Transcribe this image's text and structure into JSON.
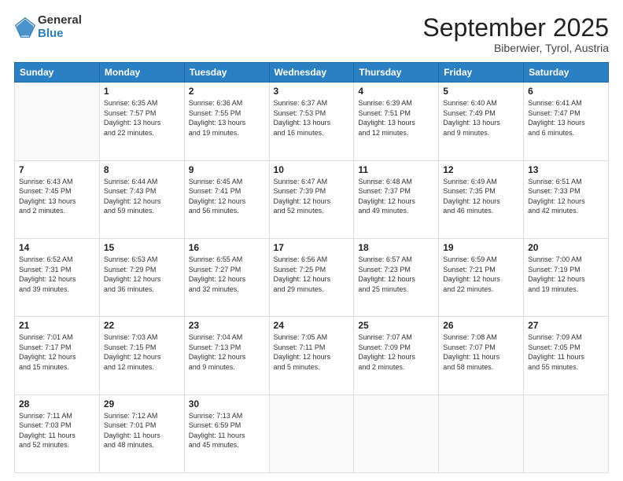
{
  "header": {
    "logo_general": "General",
    "logo_blue": "Blue",
    "month": "September 2025",
    "location": "Biberwier, Tyrol, Austria"
  },
  "weekdays": [
    "Sunday",
    "Monday",
    "Tuesday",
    "Wednesday",
    "Thursday",
    "Friday",
    "Saturday"
  ],
  "weeks": [
    [
      {
        "day": "",
        "info": ""
      },
      {
        "day": "1",
        "info": "Sunrise: 6:35 AM\nSunset: 7:57 PM\nDaylight: 13 hours\nand 22 minutes."
      },
      {
        "day": "2",
        "info": "Sunrise: 6:36 AM\nSunset: 7:55 PM\nDaylight: 13 hours\nand 19 minutes."
      },
      {
        "day": "3",
        "info": "Sunrise: 6:37 AM\nSunset: 7:53 PM\nDaylight: 13 hours\nand 16 minutes."
      },
      {
        "day": "4",
        "info": "Sunrise: 6:39 AM\nSunset: 7:51 PM\nDaylight: 13 hours\nand 12 minutes."
      },
      {
        "day": "5",
        "info": "Sunrise: 6:40 AM\nSunset: 7:49 PM\nDaylight: 13 hours\nand 9 minutes."
      },
      {
        "day": "6",
        "info": "Sunrise: 6:41 AM\nSunset: 7:47 PM\nDaylight: 13 hours\nand 6 minutes."
      }
    ],
    [
      {
        "day": "7",
        "info": "Sunrise: 6:43 AM\nSunset: 7:45 PM\nDaylight: 13 hours\nand 2 minutes."
      },
      {
        "day": "8",
        "info": "Sunrise: 6:44 AM\nSunset: 7:43 PM\nDaylight: 12 hours\nand 59 minutes."
      },
      {
        "day": "9",
        "info": "Sunrise: 6:45 AM\nSunset: 7:41 PM\nDaylight: 12 hours\nand 56 minutes."
      },
      {
        "day": "10",
        "info": "Sunrise: 6:47 AM\nSunset: 7:39 PM\nDaylight: 12 hours\nand 52 minutes."
      },
      {
        "day": "11",
        "info": "Sunrise: 6:48 AM\nSunset: 7:37 PM\nDaylight: 12 hours\nand 49 minutes."
      },
      {
        "day": "12",
        "info": "Sunrise: 6:49 AM\nSunset: 7:35 PM\nDaylight: 12 hours\nand 46 minutes."
      },
      {
        "day": "13",
        "info": "Sunrise: 6:51 AM\nSunset: 7:33 PM\nDaylight: 12 hours\nand 42 minutes."
      }
    ],
    [
      {
        "day": "14",
        "info": "Sunrise: 6:52 AM\nSunset: 7:31 PM\nDaylight: 12 hours\nand 39 minutes."
      },
      {
        "day": "15",
        "info": "Sunrise: 6:53 AM\nSunset: 7:29 PM\nDaylight: 12 hours\nand 36 minutes."
      },
      {
        "day": "16",
        "info": "Sunrise: 6:55 AM\nSunset: 7:27 PM\nDaylight: 12 hours\nand 32 minutes."
      },
      {
        "day": "17",
        "info": "Sunrise: 6:56 AM\nSunset: 7:25 PM\nDaylight: 12 hours\nand 29 minutes."
      },
      {
        "day": "18",
        "info": "Sunrise: 6:57 AM\nSunset: 7:23 PM\nDaylight: 12 hours\nand 25 minutes."
      },
      {
        "day": "19",
        "info": "Sunrise: 6:59 AM\nSunset: 7:21 PM\nDaylight: 12 hours\nand 22 minutes."
      },
      {
        "day": "20",
        "info": "Sunrise: 7:00 AM\nSunset: 7:19 PM\nDaylight: 12 hours\nand 19 minutes."
      }
    ],
    [
      {
        "day": "21",
        "info": "Sunrise: 7:01 AM\nSunset: 7:17 PM\nDaylight: 12 hours\nand 15 minutes."
      },
      {
        "day": "22",
        "info": "Sunrise: 7:03 AM\nSunset: 7:15 PM\nDaylight: 12 hours\nand 12 minutes."
      },
      {
        "day": "23",
        "info": "Sunrise: 7:04 AM\nSunset: 7:13 PM\nDaylight: 12 hours\nand 9 minutes."
      },
      {
        "day": "24",
        "info": "Sunrise: 7:05 AM\nSunset: 7:11 PM\nDaylight: 12 hours\nand 5 minutes."
      },
      {
        "day": "25",
        "info": "Sunrise: 7:07 AM\nSunset: 7:09 PM\nDaylight: 12 hours\nand 2 minutes."
      },
      {
        "day": "26",
        "info": "Sunrise: 7:08 AM\nSunset: 7:07 PM\nDaylight: 11 hours\nand 58 minutes."
      },
      {
        "day": "27",
        "info": "Sunrise: 7:09 AM\nSunset: 7:05 PM\nDaylight: 11 hours\nand 55 minutes."
      }
    ],
    [
      {
        "day": "28",
        "info": "Sunrise: 7:11 AM\nSunset: 7:03 PM\nDaylight: 11 hours\nand 52 minutes."
      },
      {
        "day": "29",
        "info": "Sunrise: 7:12 AM\nSunset: 7:01 PM\nDaylight: 11 hours\nand 48 minutes."
      },
      {
        "day": "30",
        "info": "Sunrise: 7:13 AM\nSunset: 6:59 PM\nDaylight: 11 hours\nand 45 minutes."
      },
      {
        "day": "",
        "info": ""
      },
      {
        "day": "",
        "info": ""
      },
      {
        "day": "",
        "info": ""
      },
      {
        "day": "",
        "info": ""
      }
    ]
  ]
}
